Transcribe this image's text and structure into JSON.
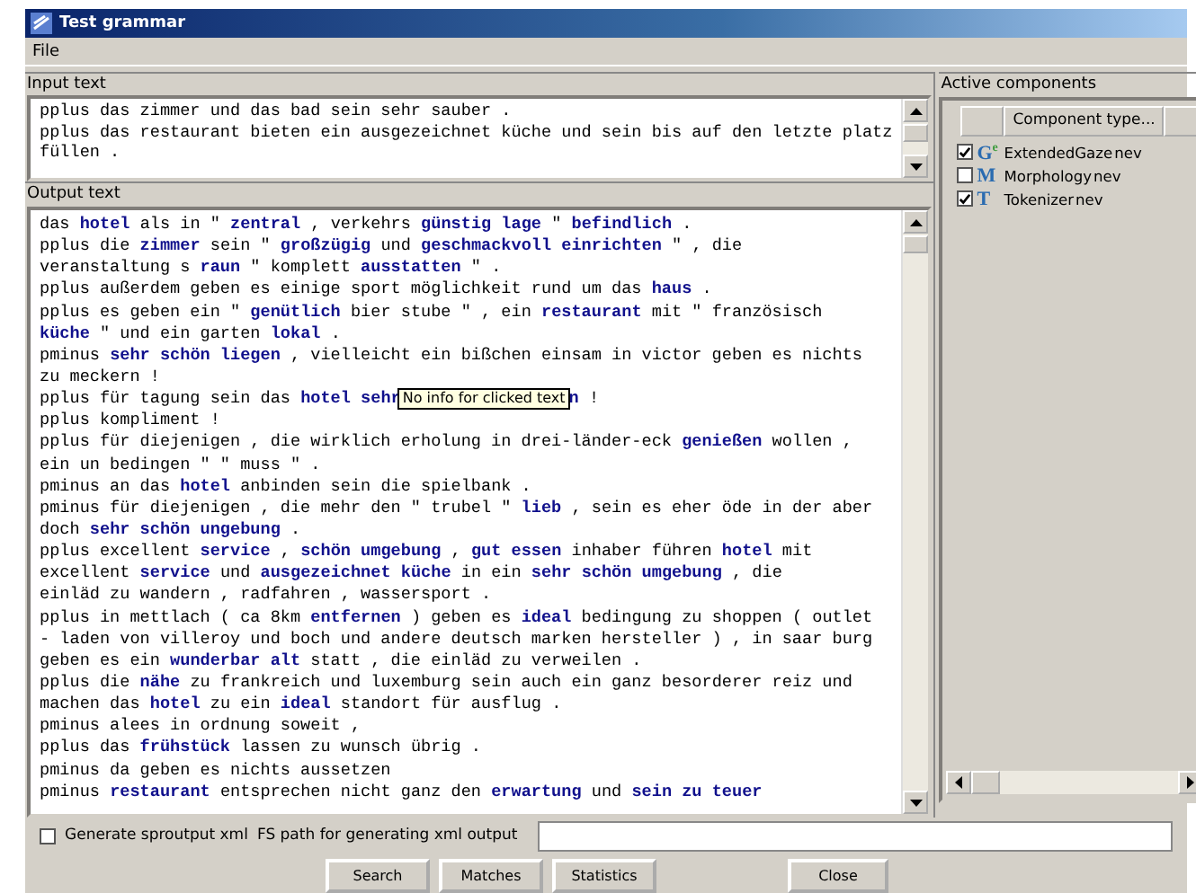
{
  "window": {
    "title": "Test grammar"
  },
  "menu": [
    "File"
  ],
  "input_text": {
    "label": "Input text",
    "lines": [
      "pplus das zimmer und das bad sein sehr sauber .",
      "pplus das restaurant bieten ein ausgezeichnet küche und sein bis auf den letzte platz",
      "füllen ."
    ]
  },
  "output_text": {
    "label": "Output text",
    "lines": [
      {
        "kind": "text",
        "text": "das **hotel** als in \" **zentral** , verkehrs **günstig lage** \" **befindlich** ."
      },
      {
        "kind": "text",
        "text": "pplus die **zimmer** sein \" **großzügig** und **geschmackvoll einrichten** \" , die"
      },
      {
        "kind": "text",
        "text": "veranstaltung s **raun** \" komplett **ausstatten** \" ."
      },
      {
        "kind": "text",
        "text": "pplus außerdem geben es einige sport möglichkeit rund um das **haus** ."
      },
      {
        "kind": "text",
        "text": "pplus es geben ein \" **genütlich** bier stube \" , ein **restaurant** mit \" französisch"
      },
      {
        "kind": "text",
        "text": "**küche** \" und ein garten **lokal** ."
      },
      {
        "kind": "text",
        "text": "pminus **sehr schön liegen** , vielleicht ein bißchen einsam in victor geben es nichts"
      },
      {
        "kind": "text",
        "text": "zu meckern !"
      },
      {
        "kind": "tooltip",
        "before": "pplus für tagung sein das **hotel sehr**",
        "tooltip": "No info for clicked text",
        "after": "**n** !"
      },
      {
        "kind": "text",
        "text": "pplus kompliment !"
      },
      {
        "kind": "text",
        "text": "pplus für diejenigen , die wirklich erholung in drei-länder-eck **genießen** wollen ,"
      },
      {
        "kind": "text",
        "text": "ein un bedingen \" \" muss \" ."
      },
      {
        "kind": "text",
        "text": "pminus an das **hotel** anbinden sein die spielbank ."
      },
      {
        "kind": "text",
        "text": "pminus für diejenigen , die mehr den \" trubel \" **lieb** , sein es eher öde in der aber"
      },
      {
        "kind": "text",
        "text": "doch **sehr schön ungebung** ."
      },
      {
        "kind": "text",
        "text": "pplus excellent **service** , **schön umgebung** , **gut essen** inhaber führen **hotel** mit"
      },
      {
        "kind": "text",
        "text": "excellent **service** und **ausgezeichnet küche** in ein **sehr schön umgebung** , die"
      },
      {
        "kind": "text",
        "text": "einläd zu wandern , radfahren , wassersport ."
      },
      {
        "kind": "text",
        "text": "pplus in mettlach ( ca 8km **entfernen** ) geben es **ideal** bedingung zu shoppen ( outlet"
      },
      {
        "kind": "text",
        "text": "- laden von villeroy und boch und andere deutsch marken hersteller ) , in saar burg"
      },
      {
        "kind": "text",
        "text": "geben es ein **wunderbar alt** statt , die einläd zu verweilen ."
      },
      {
        "kind": "text",
        "text": "pplus die **nähe** zu frankreich und luxemburg sein auch ein ganz besorderer reiz und"
      },
      {
        "kind": "text",
        "text": "machen das **hotel** zu ein **ideal** standort für ausflug ."
      },
      {
        "kind": "text",
        "text": "pminus alees in ordnung soweit ,"
      },
      {
        "kind": "text",
        "text": "pplus das **frühstück** lassen zu wunsch übrig ."
      },
      {
        "kind": "text",
        "text": "pminus da geben es nichts aussetzen"
      },
      {
        "kind": "text",
        "text": "pminus **restaurant** entsprechen nicht ganz den **erwartung** und **sein zu teuer**"
      }
    ]
  },
  "active_components": {
    "label": "Active components",
    "column_header": "Component type...",
    "rows": [
      {
        "checked": true,
        "icon": "G",
        "icon_sup": "e",
        "name": "ExtendedGaze",
        "column_2": "nev"
      },
      {
        "checked": false,
        "icon": "M",
        "name": "Morphology",
        "column_2": "nev"
      },
      {
        "checked": true,
        "icon": "T",
        "name": "Tokenizer",
        "column_2": "nev"
      }
    ]
  },
  "options": {
    "generate_checkbox": {
      "label": "Generate sproutput xml",
      "checked": false
    },
    "path_label": "FS path for generating xml output"
  },
  "buttons": [
    {
      "label": "Search",
      "kind": "left"
    },
    {
      "label": "Matches",
      "kind": "left"
    },
    {
      "label": "Statistics",
      "kind": "left"
    },
    {
      "label": "Close",
      "kind": "right"
    }
  ]
}
